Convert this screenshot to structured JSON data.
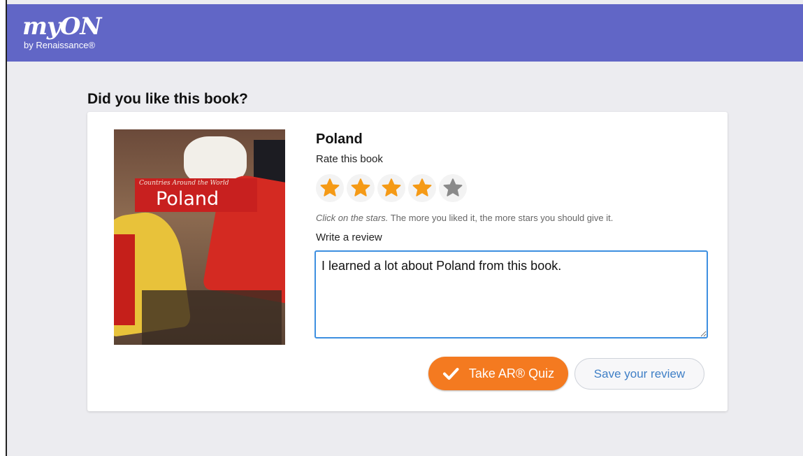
{
  "header": {
    "logo_text": "myON",
    "logo_sub": "by Renaissance®",
    "bg_color": "#6166c6"
  },
  "page": {
    "heading": "Did you like this book?"
  },
  "book": {
    "title": "Poland",
    "cover_series": "Countries Around the World",
    "cover_title": "Poland"
  },
  "rating": {
    "label": "Rate this book",
    "value": 4,
    "max": 5,
    "filled_color": "#f59a16",
    "empty_color": "#8a8a8a",
    "hint_emphasis": "Click on the stars.",
    "hint_text": "The more you liked it, the more stars you should give it."
  },
  "review": {
    "label": "Write a review",
    "value": "I learned a lot about Poland from this book."
  },
  "actions": {
    "quiz_label": "Take AR® Quiz",
    "quiz_icon": "check-icon",
    "save_label": "Save your review"
  }
}
